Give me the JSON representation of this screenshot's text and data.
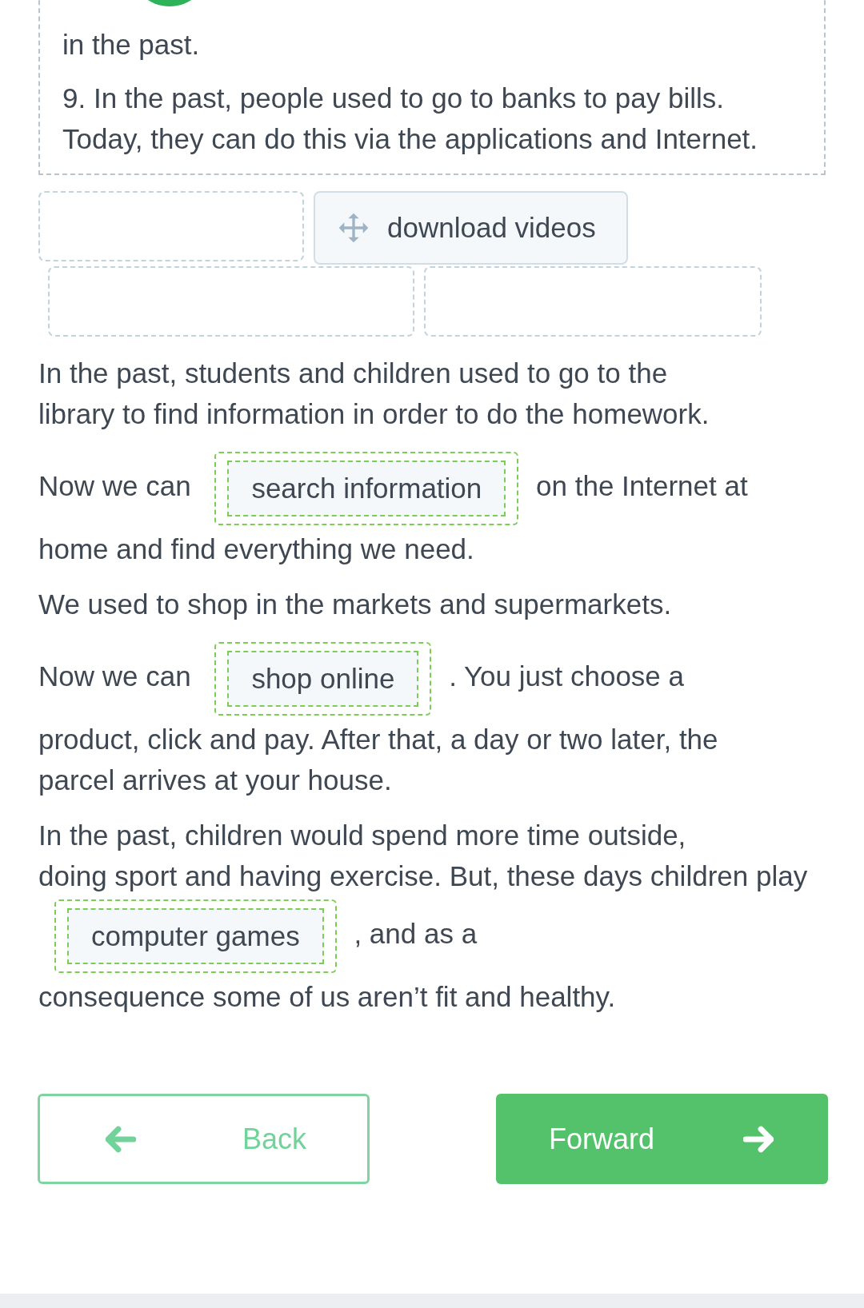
{
  "passage": {
    "paragraphs": [
      "in the past.",
      "9. In the past, people used to go to banks to pay bills. Today, they can do this via the applications and Internet."
    ]
  },
  "word_bank": [
    {
      "kind": "empty"
    },
    {
      "kind": "token",
      "label": "download videos"
    },
    {
      "kind": "empty"
    },
    {
      "kind": "empty"
    }
  ],
  "exercise": [
    {
      "segments": [
        {
          "kind": "text",
          "text": "In the past, students and children used to go to the"
        },
        {
          "kind": "text",
          "text": "library to find information in order to do the homework."
        }
      ]
    },
    {
      "segments": [
        {
          "kind": "text",
          "text": "Now we can"
        },
        {
          "kind": "answer",
          "text": "search information"
        },
        {
          "kind": "text",
          "text": "on the Internet at"
        },
        {
          "kind": "text",
          "text": "home and find everything we need."
        }
      ]
    },
    {
      "segments": [
        {
          "kind": "text",
          "text": "We used to shop in the markets and supermarkets."
        }
      ]
    },
    {
      "segments": [
        {
          "kind": "text",
          "text": "Now we can"
        },
        {
          "kind": "answer",
          "text": "shop online"
        },
        {
          "kind": "text",
          "text": ". You just choose a"
        },
        {
          "kind": "text",
          "text": "product, click and pay. After that, a day or two later, the"
        },
        {
          "kind": "text",
          "text": "parcel arrives at your house."
        }
      ]
    },
    {
      "segments": [
        {
          "kind": "text",
          "text": "In the past, children would spend more time outside,"
        },
        {
          "kind": "text",
          "text": "doing sport and having exercise. But, these days"
        },
        {
          "kind": "text",
          "text": "children play"
        },
        {
          "kind": "answer",
          "text": "computer games"
        },
        {
          "kind": "text",
          "text": ", and as a"
        },
        {
          "kind": "text",
          "text": "consequence some of us aren’t fit and healthy."
        }
      ]
    }
  ],
  "buttons": [
    {
      "kind": "back",
      "label": "Back"
    },
    {
      "kind": "forward",
      "label": "Forward"
    }
  ]
}
